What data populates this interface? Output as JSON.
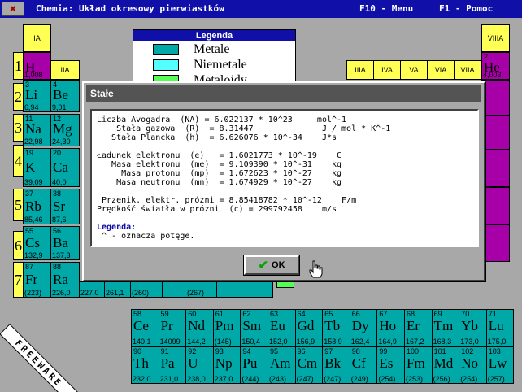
{
  "app": {
    "title": "Chemia: Układ okresowy pierwiastków",
    "menu_hint": "F10 - Menu",
    "help_hint": "F1 - Pomoc"
  },
  "colors": {
    "metal": "#00a8a8",
    "nonmetal": "#a800a8",
    "header": "#ffff54",
    "title_bg": "#1010a8",
    "desktop": "#a8a8a8"
  },
  "groups": [
    "IA",
    "IIA",
    "IIIA",
    "IVA",
    "VA",
    "VIA",
    "VIIA",
    "VIIIA"
  ],
  "periods": [
    "1",
    "2",
    "3",
    "4",
    "5",
    "6",
    "7"
  ],
  "left_elements": [
    {
      "num": "1",
      "sym": "H",
      "mass": "1,008"
    },
    {
      "num": "3",
      "sym": "Li",
      "mass": "6,94"
    },
    {
      "num": "4",
      "sym": "Be",
      "mass": "9,01"
    },
    {
      "num": "11",
      "sym": "Na",
      "mass": "22,98"
    },
    {
      "num": "12",
      "sym": "Mg",
      "mass": "24,30"
    },
    {
      "num": "19",
      "sym": "K",
      "mass": "39,09"
    },
    {
      "num": "20",
      "sym": "Ca",
      "mass": "40,0"
    },
    {
      "num": "37",
      "sym": "Rb",
      "mass": "85,46"
    },
    {
      "num": "38",
      "sym": "Sr",
      "mass": "87,6"
    },
    {
      "num": "55",
      "sym": "Cs",
      "mass": "132,9"
    },
    {
      "num": "56",
      "sym": "Ba",
      "mass": "137,3"
    },
    {
      "num": "87",
      "sym": "Fr",
      "mass": "(223)"
    },
    {
      "num": "88",
      "sym": "Ra",
      "mass": "226,0"
    }
  ],
  "right_elements": [
    {
      "num": "2",
      "sym": "He",
      "mass": "4,003"
    }
  ],
  "row7_masses": [
    "227,0",
    "261,1",
    "(260)",
    "(267)"
  ],
  "legend": {
    "title": "Legenda",
    "items": [
      {
        "label": "Metale",
        "color": "#00a8a8"
      },
      {
        "label": "Niemetale",
        "color": "#54ffff"
      },
      {
        "label": "Metaloidy",
        "color": "#54ff54"
      }
    ]
  },
  "lanthanides": [
    {
      "num": "58",
      "sym": "Ce",
      "mass": "140,1"
    },
    {
      "num": "59",
      "sym": "Pr",
      "mass": "14099"
    },
    {
      "num": "60",
      "sym": "Nd",
      "mass": "144,2"
    },
    {
      "num": "61",
      "sym": "Pm",
      "mass": "(145)"
    },
    {
      "num": "62",
      "sym": "Sm",
      "mass": "150,4"
    },
    {
      "num": "63",
      "sym": "Eu",
      "mass": "152,0"
    },
    {
      "num": "64",
      "sym": "Gd",
      "mass": "156,9"
    },
    {
      "num": "65",
      "sym": "Tb",
      "mass": "158,9"
    },
    {
      "num": "66",
      "sym": "Dy",
      "mass": "162,4"
    },
    {
      "num": "67",
      "sym": "Ho",
      "mass": "164,9"
    },
    {
      "num": "68",
      "sym": "Er",
      "mass": "167,2"
    },
    {
      "num": "69",
      "sym": "Tm",
      "mass": "168,3"
    },
    {
      "num": "70",
      "sym": "Yb",
      "mass": "173,0"
    },
    {
      "num": "71",
      "sym": "Lu",
      "mass": "175,0"
    }
  ],
  "actinides": [
    {
      "num": "90",
      "sym": "Th",
      "mass": "232,0"
    },
    {
      "num": "91",
      "sym": "Pa",
      "mass": "231,0"
    },
    {
      "num": "92",
      "sym": "U",
      "mass": "238,0"
    },
    {
      "num": "93",
      "sym": "Np",
      "mass": "237,0"
    },
    {
      "num": "94",
      "sym": "Pu",
      "mass": "(244)"
    },
    {
      "num": "95",
      "sym": "Am",
      "mass": "(243)"
    },
    {
      "num": "96",
      "sym": "Cm",
      "mass": "(247)"
    },
    {
      "num": "97",
      "sym": "Bk",
      "mass": "(247)"
    },
    {
      "num": "98",
      "sym": "Cf",
      "mass": "(249)"
    },
    {
      "num": "99",
      "sym": "Es",
      "mass": "(254)"
    },
    {
      "num": "100",
      "sym": "Fm",
      "mass": "(253)"
    },
    {
      "num": "101",
      "sym": "Md",
      "mass": "(256)"
    },
    {
      "num": "102",
      "sym": "No",
      "mass": "(254)"
    },
    {
      "num": "103",
      "sym": "Lw",
      "mass": "(257)"
    }
  ],
  "freeware": "FREEWARE",
  "dialog": {
    "title": "Stałe",
    "lines": [
      "Liczba Avogadra  (NA) = 6.022137 * 10^23     mol^-1",
      "    Stała gazowa  (R)  = 8.31447              J / mol * K^-1",
      "   Stała Plancka  (h)  = 6.626076 * 10^-34    J*s",
      "",
      "Ładunek elektronu  (e)   = 1.6021773 * 10^-19    C",
      "   Masa elektronu  (me)  = 9.109390 * 10^-31    kg",
      "     Masa protonu  (mp)  = 1.672623 * 10^-27    kg",
      "    Masa neutronu  (mn)  = 1.674929 * 10^-27    kg",
      "",
      " Przenik. elektr. próżni = 8.85418782 * 10^-12    F/m",
      "Prędkość światła w próżni  (c) = 299792458    m/s",
      ""
    ],
    "legend_header": "Legenda:",
    "legend_text": " ^ - oznacza potęge.",
    "ok_label": "OK"
  }
}
